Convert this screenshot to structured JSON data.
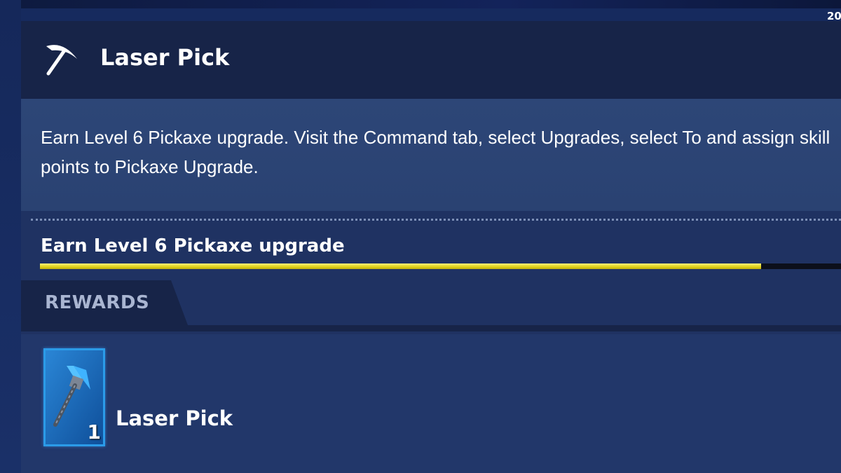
{
  "top_corner_text": "20",
  "header": {
    "icon": "pickaxe-icon",
    "title": "Laser Pick"
  },
  "description": "Earn Level 6 Pickaxe upgrade. Visit the Command tab, select Upgrades, select To and assign skill points to Pickaxe Upgrade.",
  "objective": {
    "title": "Earn Level 6 Pickaxe upgrade",
    "progress": 0.9
  },
  "rewards": {
    "label": "REWARDS",
    "items": [
      {
        "icon": "laser-pick-icon",
        "name": "Laser Pick",
        "quantity": "1"
      }
    ]
  },
  "colors": {
    "progress_fill": "#e3d51e",
    "progress_track": "#0c0f1b",
    "card_border": "#2b9be8",
    "header_bg": "#172448"
  }
}
